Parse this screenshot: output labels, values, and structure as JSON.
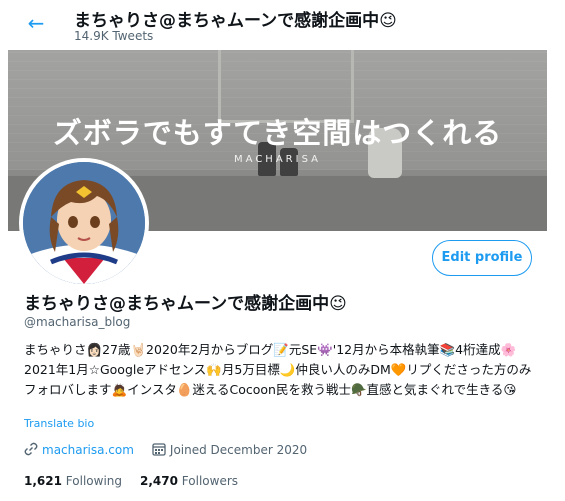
{
  "header": {
    "back_icon": "arrow-left-icon",
    "title": "まちゃりさ@まちゃムーンで感謝企画中😉",
    "subtitle": "14.9K Tweets"
  },
  "banner": {
    "headline": "ズボラでもすてき空間はつくれる",
    "watermark": "MACHARISA"
  },
  "profile": {
    "display_name": "まちゃりさ@まちゃムーンで感謝企画中😉",
    "handle": "@macharisa_blog",
    "edit_label": "Edit profile",
    "bio": "まちゃりさ👩🏻27歳🤘🏻2020年2月からブログ📝元SE👾'12月から本格執筆📚4桁達成🌸2021年1月☆Googleアドセンス🙌月5万目標🌙仲良い人のみDM🧡リプくださった方のみフォロバします🙇インスタ🥚迷えるCocoon民を救う戦士🪖直感と気まぐれで生きる😘",
    "translate_label": "Translate bio",
    "website": "macharisa.com",
    "joined": "Joined December 2020",
    "following_count": "1,621",
    "following_label": "Following",
    "followers_count": "2,470",
    "followers_label": "Followers"
  },
  "colors": {
    "accent": "#1d9bf0",
    "secondary_text": "#536471",
    "primary_text": "#0f1419"
  },
  "icons": {
    "website": "link-icon",
    "joined": "calendar-icon"
  }
}
